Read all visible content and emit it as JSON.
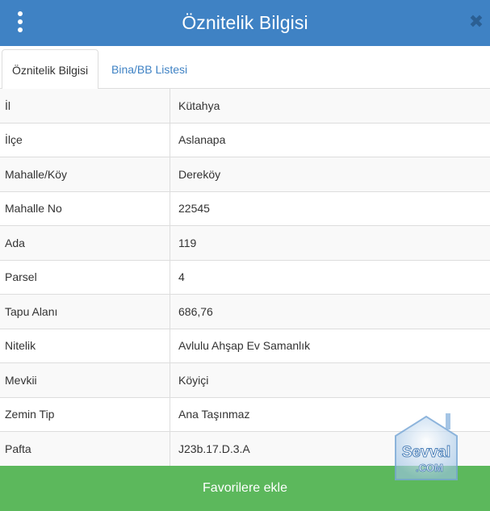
{
  "header": {
    "title": "Öznitelik Bilgisi",
    "menu_icon": "kebab-menu-icon",
    "close_icon": "close-icon",
    "close_glyph": "✖"
  },
  "tabs": [
    {
      "label": "Öznitelik Bilgisi",
      "active": true
    },
    {
      "label": "Bina/BB Listesi",
      "active": false
    }
  ],
  "attributes": [
    {
      "key": "İl",
      "value": "Kütahya"
    },
    {
      "key": "İlçe",
      "value": "Aslanapa"
    },
    {
      "key": "Mahalle/Köy",
      "value": "Dereköy"
    },
    {
      "key": "Mahalle No",
      "value": "22545"
    },
    {
      "key": "Ada",
      "value": "119"
    },
    {
      "key": "Parsel",
      "value": "4"
    },
    {
      "key": "Tapu Alanı",
      "value": "686,76"
    },
    {
      "key": "Nitelik",
      "value": "Avlulu Ahşap Ev Samanlık"
    },
    {
      "key": "Mevkii",
      "value": "Köyiçi"
    },
    {
      "key": "Zemin Tip",
      "value": "Ana Taşınmaz"
    },
    {
      "key": "Pafta",
      "value": "J23b.17.D.3.A"
    }
  ],
  "footer": {
    "favorite_label": "Favorilere ekle"
  },
  "watermark": {
    "line1": "Sevval",
    "line2": ".COM"
  },
  "colors": {
    "header": "#3f82c4",
    "tab_link": "#3f82c4",
    "button": "#5cb85c",
    "border": "#dddddd"
  }
}
